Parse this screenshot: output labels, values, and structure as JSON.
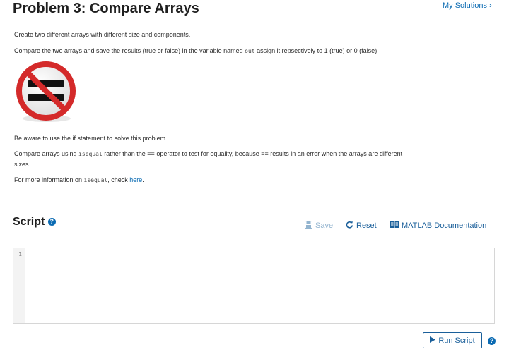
{
  "header": {
    "title": "Problem 3: Compare Arrays",
    "my_solutions": "My Solutions"
  },
  "problem": {
    "line1": "Create two different arrays with different size and components.",
    "line2_before": "Compare the two arrays and save the results (true or false) in the variable named ",
    "line2_code": "out",
    "line2_after": " assign it repsectively to 1 (true) or 0 (false).",
    "line3": "Be aware to use the if statement to solve this problem.",
    "line4_before": "Compare arrays using ",
    "line4_code": "isequal",
    "line4_mid": " rather than the == operator to test for equality, because == results in an error when the arrays are different",
    "line4_cont": "sizes.",
    "line5_before": "For more information on ",
    "line5_code": "isequal",
    "line5_mid": ", check ",
    "line5_link": "here",
    "line5_end": "."
  },
  "script": {
    "title": "Script",
    "save_label": "Save",
    "reset_label": "Reset",
    "doc_label": "MATLAB Documentation",
    "line_numbers": [
      "1"
    ],
    "code": ""
  },
  "footer": {
    "run_label": "Run Script"
  },
  "colors": {
    "accent": "#0b6bb3",
    "save_disabled": "#93b4cf",
    "sign_red": "#d42a2a"
  },
  "icons": [
    "chevron-right-icon",
    "no-equal-sign-icon",
    "help-icon",
    "save-icon",
    "reset-icon",
    "documentation-icon",
    "play-icon"
  ]
}
